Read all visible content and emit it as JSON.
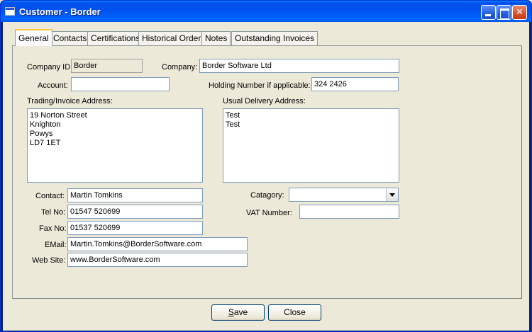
{
  "window": {
    "title": "Customer - Border"
  },
  "tabs": [
    {
      "label": "General",
      "active": true
    },
    {
      "label": "Contacts"
    },
    {
      "label": "Certifications"
    },
    {
      "label": "Historical Orders"
    },
    {
      "label": "Notes"
    },
    {
      "label": "Outstanding Invoices"
    }
  ],
  "general": {
    "company_id_label": "Company ID:",
    "company_id_value": "Border",
    "company_label": "Company:",
    "company_value": "Border Software Ltd",
    "account_label": "Account:",
    "account_value": "",
    "holding_label": "Holding Number if applicable:",
    "holding_value": "324 2426",
    "trading_address_label": "Trading/Invoice Address:",
    "trading_address_value": "19 Norton Street\nKnighton\nPowys\nLD7 1ET",
    "delivery_address_label": "Usual Delivery Address:",
    "delivery_address_value": "Test\nTest",
    "contact_label": "Contact:",
    "contact_value": "Martin Tomkins",
    "tel_label": "Tel No:",
    "tel_value": "01547 520699",
    "fax_label": "Fax No:",
    "fax_value": "01537 520699",
    "email_label": "EMail:",
    "email_value": "Martin.Tomkins@BorderSoftware.com",
    "website_label": "Web Site:",
    "website_value": "www.BorderSoftware.com",
    "category_label": "Catagory:",
    "category_value": "",
    "vat_label": "VAT Number:",
    "vat_value": ""
  },
  "buttons": {
    "save_accel": "S",
    "save_rest": "ave",
    "close_label": "Close"
  },
  "colors": {
    "titlebar": "#0053ee",
    "client_bg": "#ece9d8",
    "active_tab_accent": "#ffc83c"
  }
}
